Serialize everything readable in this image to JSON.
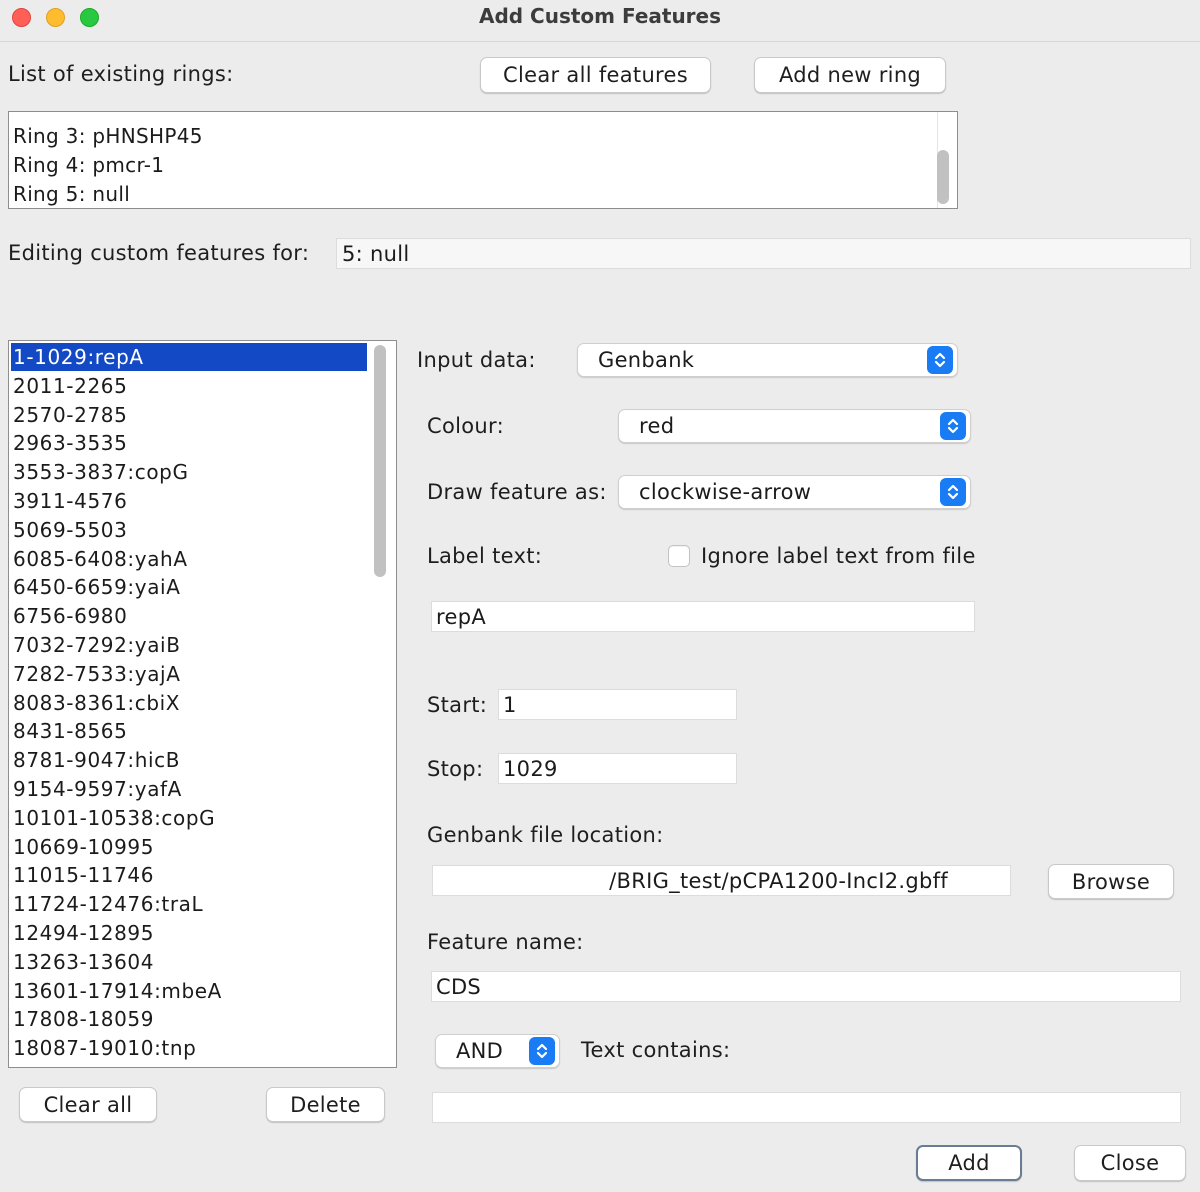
{
  "window": {
    "title": "Add Custom Features"
  },
  "rings": {
    "label": "List of existing rings:",
    "clear_all_features": "Clear all features",
    "add_new_ring": "Add new ring",
    "items": [
      "Ring 3: pHNSHP45",
      "Ring 4: pmcr-1",
      "Ring 5: null"
    ]
  },
  "editing": {
    "label": "Editing custom features for:",
    "value": "5: null"
  },
  "features": {
    "items": [
      "1-1029:repA",
      "2011-2265",
      "2570-2785",
      "2963-3535",
      "3553-3837:copG",
      "3911-4576",
      "5069-5503",
      "6085-6408:yahA",
      "6450-6659:yaiA",
      "6756-6980",
      "7032-7292:yaiB",
      "7282-7533:yajA",
      "8083-8361:cbiX",
      "8431-8565",
      "8781-9047:hicB",
      "9154-9597:yafA",
      "10101-10538:copG",
      "10669-10995",
      "11015-11746",
      "11724-12476:traL",
      "12494-12895",
      "13263-13604",
      "13601-17914:mbeA",
      "17808-18059",
      "18087-19010:tnp"
    ],
    "selected_index": 0,
    "clear_all": "Clear all",
    "delete": "Delete"
  },
  "form": {
    "input_data_label": "Input data:",
    "input_data_value": "Genbank",
    "colour_label": "Colour:",
    "colour_value": "red",
    "draw_label": "Draw feature as:",
    "draw_value": "clockwise-arrow",
    "label_text_label": "Label text:",
    "ignore_label_text": "Ignore label text from file",
    "ignore_checked": false,
    "label_text_value": "repA",
    "start_label": "Start:",
    "start_value": "1",
    "stop_label": "Stop:",
    "stop_value": "1029",
    "genbank_label": "Genbank file location:",
    "genbank_value": "/BRIG_test/pCPA1200-IncI2.gbff",
    "browse": "Browse",
    "feature_name_label": "Feature name:",
    "feature_name_value": "CDS",
    "logic_value": "AND",
    "text_contains_label": "Text contains:",
    "text_contains_value": "",
    "add": "Add",
    "close": "Close"
  },
  "colors": {
    "selection": "#1449c6",
    "accent": "#1a7cf5"
  }
}
